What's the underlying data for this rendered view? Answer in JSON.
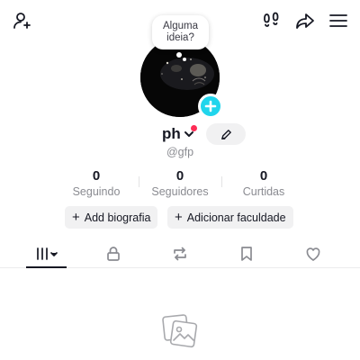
{
  "profile": {
    "name": "ph",
    "handle": "@gfp",
    "bubble_line1": "Alguma",
    "bubble_line2": "ideia?"
  },
  "stats": [
    {
      "value": "0",
      "label": "Seguindo"
    },
    {
      "value": "0",
      "label": "Seguidores"
    },
    {
      "value": "0",
      "label": "Curtidas"
    }
  ],
  "actions": {
    "add_bio": "Add biografia",
    "add_school": "Adicionar faculdade",
    "plus_symbol": "+"
  },
  "icons": {
    "top_left": "add-user-icon",
    "top_right": [
      "footprints-icon",
      "share-icon",
      "menu-icon"
    ],
    "tabs": [
      "grid-icon",
      "lock-icon",
      "repost-icon",
      "bookmark-icon",
      "heart-icon"
    ],
    "empty": "photos-icon"
  },
  "colors": {
    "accent": "#20d5ec",
    "notification": "#fe2c55",
    "text": "#161823",
    "muted": "#8a8b91",
    "pill_bg": "#f1f1f2"
  }
}
